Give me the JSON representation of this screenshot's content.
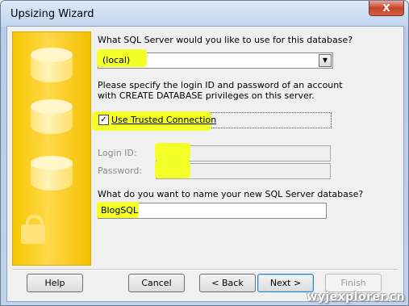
{
  "window": {
    "title": "Upsizing Wizard",
    "close_symbol": "X"
  },
  "wizard": {
    "server_question": "What SQL Server would you like to use for this database?",
    "server_value": "(local)",
    "login_instructions_line1": "Please specify the login ID and password of an account",
    "login_instructions_line2": "with CREATE DATABASE privileges on this server.",
    "trusted_connection_label": "Use Trusted Connection",
    "trusted_connection_checked": "✓",
    "login_id_label": "Login ID:",
    "login_id_value": "",
    "password_label": "Password:",
    "password_value": "",
    "db_name_question": "What do you want to name your new SQL Server database?",
    "db_name_value": "BlogSQL"
  },
  "buttons": {
    "help": "Help",
    "cancel": "Cancel",
    "back": "< Back",
    "next": "Next >",
    "finish": "Finish"
  },
  "watermark": "wyjexplorer.cn",
  "icons": [
    "close-icon",
    "database-icon",
    "lock-icon",
    "dropdown-arrow-icon",
    "checkmark-icon"
  ],
  "colors": {
    "highlight": "#f4ff2a",
    "side_panel": "#f6c800",
    "title_bar": "#c1d5ef"
  }
}
